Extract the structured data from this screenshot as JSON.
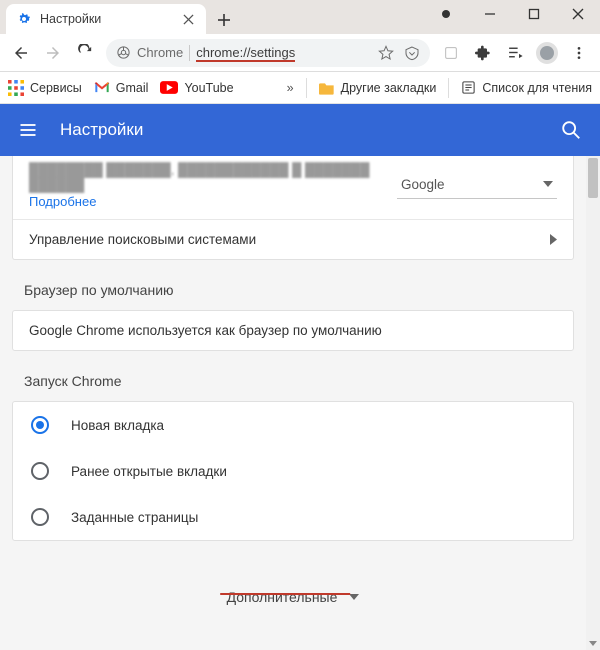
{
  "window": {
    "tab_title": "Настройки"
  },
  "omnibox": {
    "origin": "Chrome",
    "url": "chrome://settings"
  },
  "bookmarks": {
    "services": "Сервисы",
    "gmail": "Gmail",
    "youtube": "YouTube",
    "other_bookmarks": "Другие закладки",
    "reading_list": "Список для чтения"
  },
  "header": {
    "title": "Настройки"
  },
  "search_engine": {
    "more": "Подробнее",
    "selected": "Google",
    "manage": "Управление поисковыми системами"
  },
  "default_browser": {
    "title": "Браузер по умолчанию",
    "status": "Google Chrome используется как браузер по умолчанию"
  },
  "startup": {
    "title": "Запуск Chrome",
    "options": {
      "new_tab": "Новая вкладка",
      "previous": "Ранее открытые вкладки",
      "specific": "Заданные страницы"
    },
    "selected": "new_tab"
  },
  "advanced": "Дополнительные"
}
